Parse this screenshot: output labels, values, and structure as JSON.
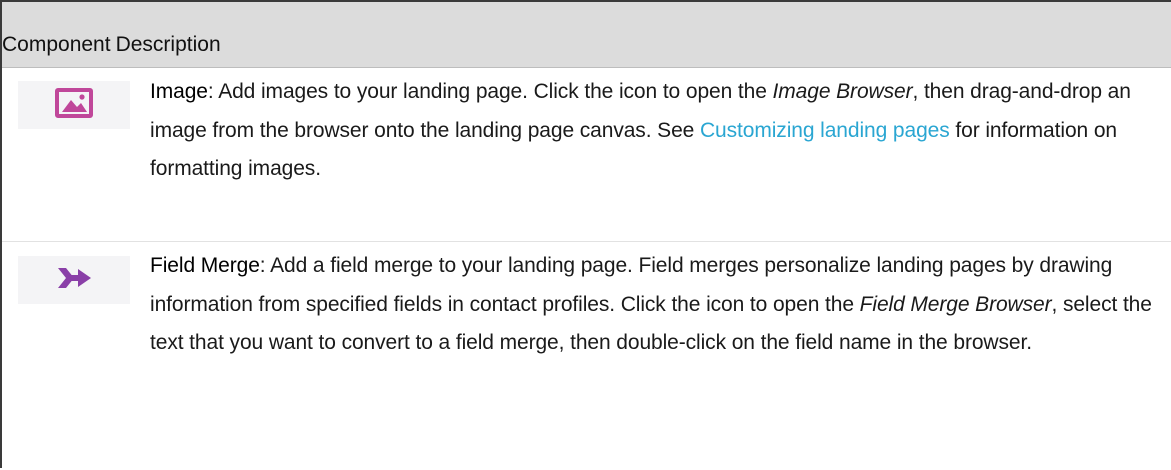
{
  "table": {
    "headers": {
      "component": "Component",
      "description": "Description"
    },
    "rows": [
      {
        "icon": "image-icon",
        "icon_color": "#c0479a",
        "term": "Image",
        "sep": ": ",
        "text_1": "Add images to your landing page. Click the icon to open the ",
        "em_1": "Image Browser",
        "text_2": ", then drag-and-drop an image from the browser onto the landing page canvas. See ",
        "link": "Customizing landing pages",
        "text_3": " for information on formatting images."
      },
      {
        "icon": "field-merge-icon",
        "icon_color": "#8a3fa8",
        "term": "Field Merge",
        "sep": ": ",
        "text_1": "Add a field merge to your landing page. Field merges personalize landing pages by drawing information from specified fields in contact profiles. Click the icon to open the ",
        "em_1": "Field Merge Browser",
        "text_2": ", select the text that you want to convert to a field merge, then double-click on the field name in the browser."
      }
    ]
  },
  "colors": {
    "header_bg": "#dcdcdc",
    "link": "#2aa6d2",
    "icon_bg": "#f4f4f6"
  }
}
